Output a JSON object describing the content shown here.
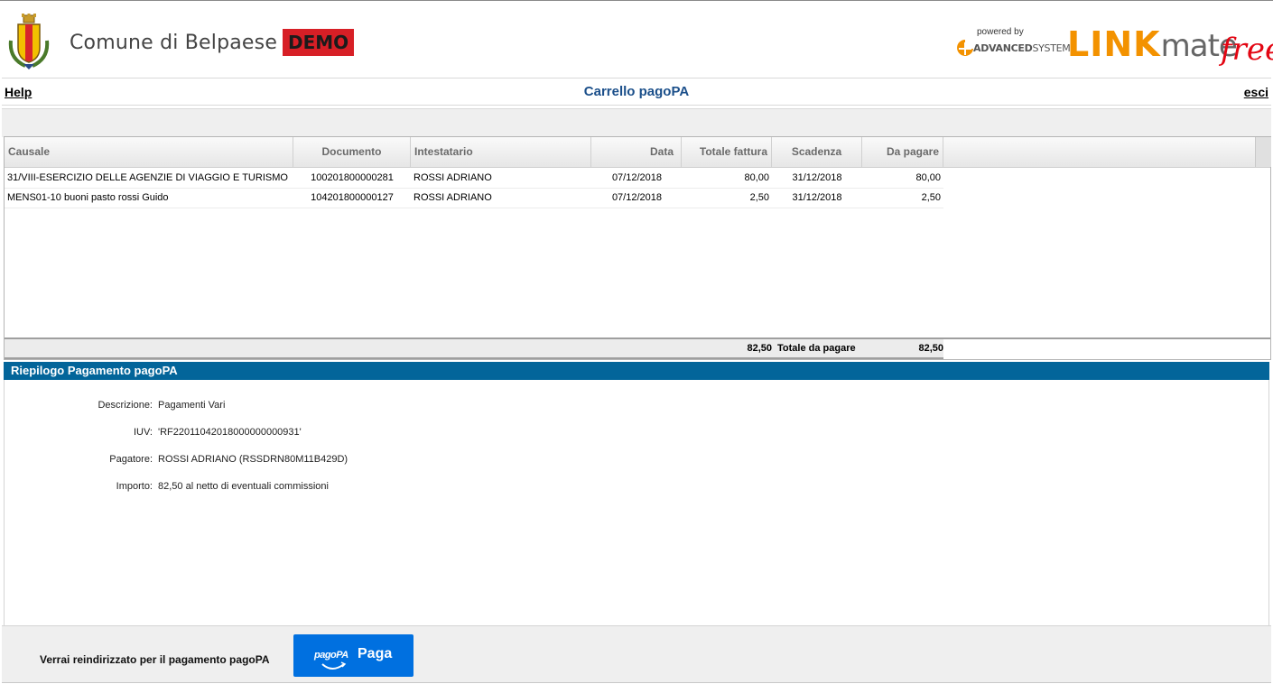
{
  "header": {
    "comune": "Comune di Belpaese",
    "demo": "DEMO",
    "powered_by": "powered by",
    "advanced_a": "ADVANCED",
    "advanced_b": "SYSTEMS",
    "link_a": "LINK",
    "link_b": "mate",
    "link_c": "free"
  },
  "nav": {
    "help": "Help",
    "title": "Carrello pagoPA",
    "esci": "esci"
  },
  "grid": {
    "columns": {
      "causale": "Causale",
      "documento": "Documento",
      "intestatario": "Intestatario",
      "data": "Data",
      "totale_fattura": "Totale fattura",
      "scadenza": "Scadenza",
      "da_pagare": "Da pagare"
    },
    "rows": [
      {
        "causale": "31/VIII-ESERCIZIO DELLE AGENZIE DI VIAGGIO E TURISMO",
        "documento": "100201800000281",
        "intestatario": "ROSSI ADRIANO",
        "data": "07/12/2018",
        "totale_fattura": "80,00",
        "scadenza": "31/12/2018",
        "da_pagare": "80,00"
      },
      {
        "causale": "MENS01-10 buoni pasto rossi Guido",
        "documento": "104201800000127",
        "intestatario": "ROSSI ADRIANO",
        "data": "07/12/2018",
        "totale_fattura": "2,50",
        "scadenza": "31/12/2018",
        "da_pagare": "2,50"
      }
    ],
    "footer": {
      "totale_fattura": "82,50",
      "label": "Totale da pagare",
      "da_pagare": "82,50"
    }
  },
  "riepilogo": {
    "title": "Riepilogo Pagamento pagoPA",
    "descrizione_label": "Descrizione:",
    "descrizione": "Pagamenti Vari",
    "iuv_label": "IUV:",
    "iuv": "'RF22011042018000000000931'",
    "pagatore_label": "Pagatore:",
    "pagatore": "ROSSI ADRIANO (RSSDRN80M11B429D)",
    "importo_label": "Importo:",
    "importo": "82,50 al netto di eventuali commissioni"
  },
  "footer": {
    "text": "Verrai reindirizzato per il pagamento pagoPA",
    "pagopa": "pagoPA",
    "button": "Paga"
  },
  "colors": {
    "accent_blue": "#03659a",
    "title_blue": "#1b4f8a",
    "demo_red": "#d71f26",
    "pay_button": "#0070e0",
    "brand_orange": "#f39200"
  }
}
